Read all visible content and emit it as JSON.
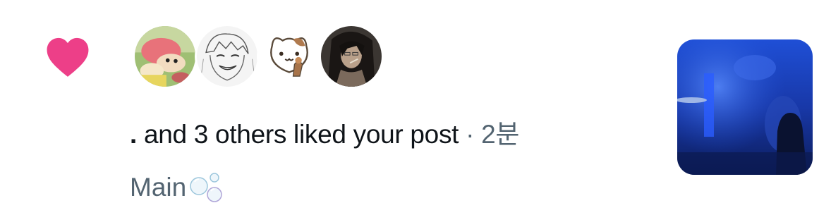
{
  "notification": {
    "icon": "heart-icon",
    "icon_color": "#f91880",
    "avatars": [
      {
        "name": "cartoon-avatar",
        "icon": "avatar-image"
      },
      {
        "name": "sketch-avatar",
        "icon": "avatar-image"
      },
      {
        "name": "cat-avatar",
        "icon": "avatar-image"
      },
      {
        "name": "anime-avatar",
        "icon": "avatar-image"
      }
    ],
    "handle": ".",
    "action_text": "and 3 others liked your post",
    "separator": "·",
    "timestamp": "2분",
    "post_text": "Main",
    "post_emoji": "bubbles-icon",
    "text_color": "#0f1419",
    "secondary_color": "#536471"
  }
}
